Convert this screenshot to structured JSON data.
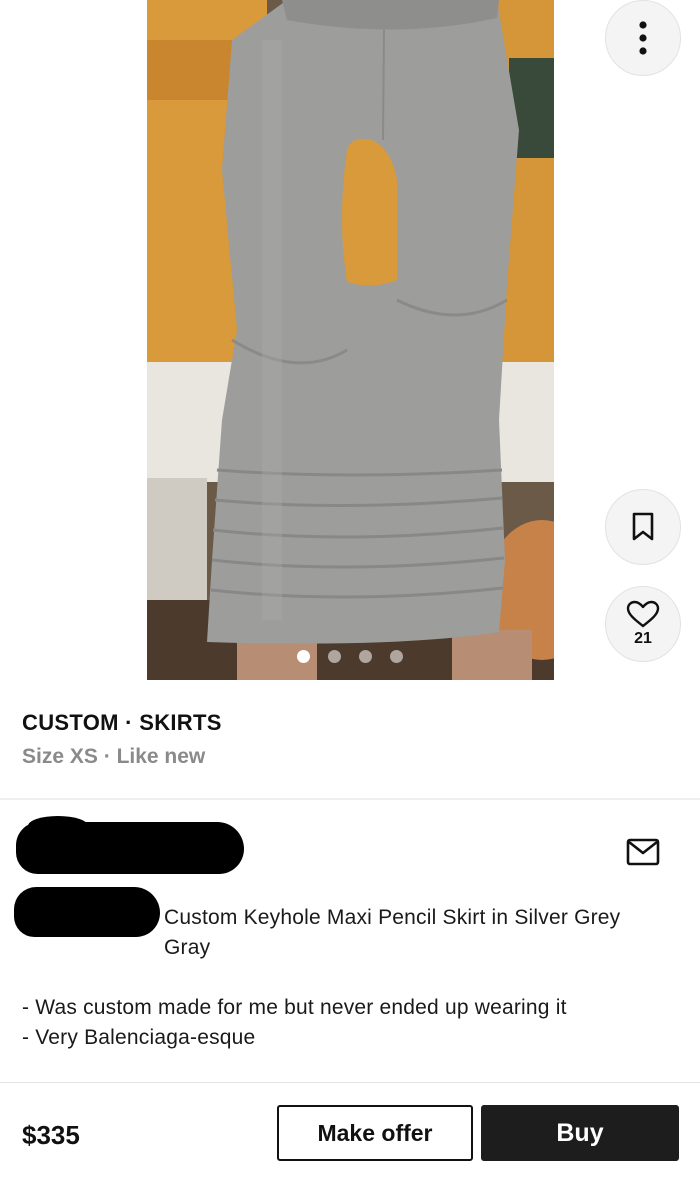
{
  "listing": {
    "brand": "CUSTOM",
    "category": "SKIRTS",
    "size": "Size XS",
    "condition": "Like new",
    "separator": "·",
    "likes": "21",
    "image_count": 4,
    "active_image": 1
  },
  "description": {
    "title": "Custom Keyhole Maxi Pencil Skirt in Silver Grey Gray",
    "lines": [
      "- Was custom made for me but never ended up wearing it",
      "- Very Balenciaga-esque"
    ]
  },
  "actions": {
    "price": "$335",
    "offer_label": "Make offer",
    "buy_label": "Buy"
  },
  "icons": {
    "more": "more-vertical-icon",
    "save": "bookmark-icon",
    "like": "heart-icon",
    "message": "mail-icon"
  },
  "colors": {
    "buy_button": "#1d1d1d",
    "muted_text": "#8a8a8a"
  }
}
